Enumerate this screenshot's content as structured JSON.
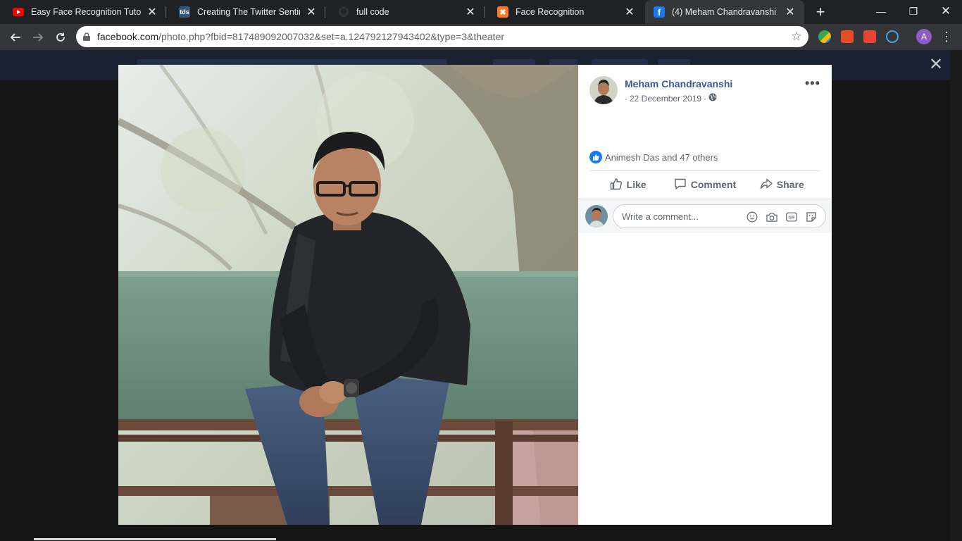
{
  "browser": {
    "tabs": [
      {
        "title": "Easy Face Recognition Tutorial",
        "favicon": "youtube-icon",
        "active": false
      },
      {
        "title": "Creating The Twitter Sentiment",
        "favicon": "tds-icon",
        "active": false
      },
      {
        "title": "full code",
        "favicon": "github-icon",
        "active": false
      },
      {
        "title": "Face Recognition",
        "favicon": "xampp-icon",
        "active": false
      },
      {
        "title": "(4) Meham Chandravanshi",
        "favicon": "facebook-icon",
        "active": true
      }
    ],
    "url_host": "facebook.com",
    "url_rest": "/photo.php?fbid=817489092007032&set=a.124792127943402&type=3&theater",
    "profile_initial": "A"
  },
  "post": {
    "author": "Meham Chandravanshi",
    "date": "22 December 2019",
    "reactions_text": "Animesh Das and 47 others",
    "actions": {
      "like": "Like",
      "comment": "Comment",
      "share": "Share"
    },
    "comment_placeholder": "Write a comment..."
  },
  "colors": {
    "facebook_blue": "#1877f2",
    "author_link": "#385898",
    "chrome_dark": "#202124",
    "chrome_toolbar": "#35363a"
  }
}
